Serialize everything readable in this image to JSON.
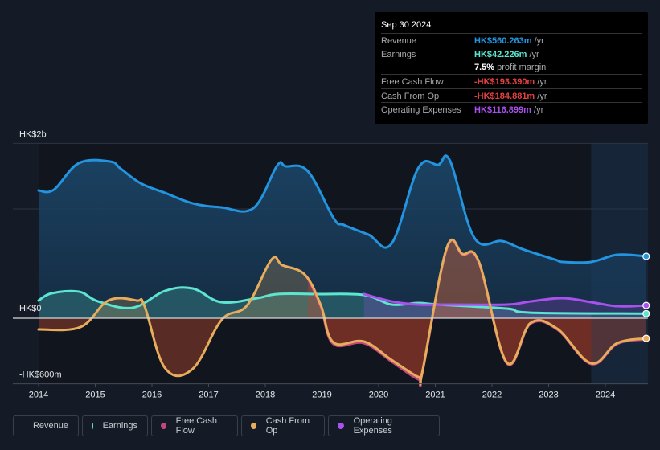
{
  "tooltip": {
    "date": "Sep 30 2024",
    "rows": [
      {
        "label": "Revenue",
        "value": "HK$560.263m",
        "unit": "/yr",
        "color": "#2394df"
      },
      {
        "label": "Earnings",
        "value": "HK$42.226m",
        "unit": "/yr",
        "color": "#5ce5cf"
      },
      {
        "label": "",
        "value": "7.5%",
        "unit": "profit margin",
        "color": "#ffffff"
      },
      {
        "label": "Free Cash Flow",
        "value": "-HK$193.390m",
        "unit": "/yr",
        "color": "#e64141"
      },
      {
        "label": "Cash From Op",
        "value": "-HK$184.881m",
        "unit": "/yr",
        "color": "#e64141"
      },
      {
        "label": "Operating Expenses",
        "value": "HK$116.899m",
        "unit": "/yr",
        "color": "#a951ed"
      }
    ]
  },
  "legend": [
    {
      "label": "Revenue",
      "color": "#2394df"
    },
    {
      "label": "Earnings",
      "color": "#5ce5cf"
    },
    {
      "label": "Free Cash Flow",
      "color": "#c1477e"
    },
    {
      "label": "Cash From Op",
      "color": "#e8ad5c"
    },
    {
      "label": "Operating Expenses",
      "color": "#a951ed"
    }
  ],
  "chart_data": {
    "type": "area",
    "title": "",
    "xlabel": "",
    "ylabel": "",
    "y_unit": "HK$ millions",
    "ylim": [
      -600,
      1600
    ],
    "xlim": [
      2014,
      2024.75
    ],
    "y_tick_labels": [
      {
        "value": 2000,
        "label": "HK$2b"
      },
      {
        "value": 0,
        "label": "HK$0"
      },
      {
        "value": -600,
        "label": "-HK$600m"
      }
    ],
    "x_tick_labels": [
      "2014",
      "2015",
      "2016",
      "2017",
      "2018",
      "2019",
      "2020",
      "2021",
      "2022",
      "2023",
      "2024"
    ],
    "x_ticks": [
      2014,
      2015,
      2016,
      2017,
      2018,
      2019,
      2020,
      2021,
      2022,
      2023,
      2024
    ],
    "gridlines": [
      1600,
      1000
    ],
    "forecast_shade_start": 2023.75,
    "legend_position": "bottom-left",
    "series": [
      {
        "name": "Revenue",
        "color": "#2394df",
        "x": [
          2014,
          2014.27,
          2014.71,
          2015.26,
          2015.45,
          2015.8,
          2016.23,
          2016.72,
          2017.22,
          2017.79,
          2018.21,
          2018.36,
          2018.75,
          2019.21,
          2019.39,
          2019.82,
          2020.23,
          2020.7,
          2021.05,
          2021.26,
          2021.69,
          2022.18,
          2022.54,
          2023.11,
          2023.25,
          2023.75,
          2024.21,
          2024.72
        ],
        "y": [
          1169,
          1176,
          1419,
          1434,
          1368,
          1235,
          1147,
          1051,
          1015,
          1007,
          1397,
          1390,
          1346,
          912,
          853,
          765,
          684,
          1375,
          1404,
          1441,
          735,
          706,
          632,
          537,
          515,
          515,
          581,
          566
        ]
      },
      {
        "name": "Earnings",
        "color": "#5ce5cf",
        "x": [
          2014,
          2014.23,
          2014.71,
          2015.05,
          2015.66,
          2016.23,
          2016.72,
          2017.22,
          2017.86,
          2018.21,
          2018.92,
          2019.74,
          2020.23,
          2020.7,
          2021.05,
          2022.26,
          2022.68,
          2024.72
        ],
        "y": [
          162,
          228,
          243,
          154,
          96,
          250,
          272,
          147,
          184,
          221,
          221,
          213,
          125,
          140,
          125,
          88,
          51,
          42
        ]
      },
      {
        "name": "Cash From Op",
        "color": "#e8ad5c",
        "x": [
          2014,
          2014.74,
          2015.23,
          2015.73,
          2015.87,
          2016.23,
          2016.72,
          2017.23,
          2017.68,
          2018.11,
          2018.3,
          2018.7,
          2018.98,
          2019.2,
          2019.74,
          2020.23,
          2020.7,
          2020.77,
          2021.2,
          2021.48,
          2021.77,
          2022.26,
          2022.68,
          2023.15,
          2023.75,
          2024.21,
          2024.72
        ],
        "y": [
          -103,
          -81,
          162,
          162,
          110,
          -456,
          -463,
          -15,
          118,
          537,
          485,
          397,
          118,
          -221,
          -213,
          -382,
          -537,
          -493,
          640,
          588,
          515,
          -404,
          -44,
          -96,
          -412,
          -228,
          -185
        ]
      },
      {
        "name": "Free Cash Flow",
        "color": "#c1477e",
        "x": [
          2018.75,
          2018.98,
          2019.2,
          2019.74,
          2020.23,
          2020.7,
          2020.77,
          2021.2,
          2021.48,
          2021.77,
          2022.26,
          2022.68,
          2023.15,
          2023.75,
          2024.21,
          2024.72
        ],
        "y": [
          368,
          103,
          -235,
          -228,
          -397,
          -559,
          -503,
          632,
          580,
          507,
          -412,
          -51,
          -103,
          -419,
          -235,
          -193
        ]
      },
      {
        "name": "Operating Expenses",
        "color": "#a951ed",
        "x": [
          2019.74,
          2020.23,
          2020.7,
          2021.26,
          2022.26,
          2022.68,
          2023.25,
          2023.75,
          2024.21,
          2024.72
        ],
        "y": [
          221,
          154,
          125,
          125,
          125,
          154,
          184,
          147,
          110,
          117
        ]
      }
    ]
  }
}
